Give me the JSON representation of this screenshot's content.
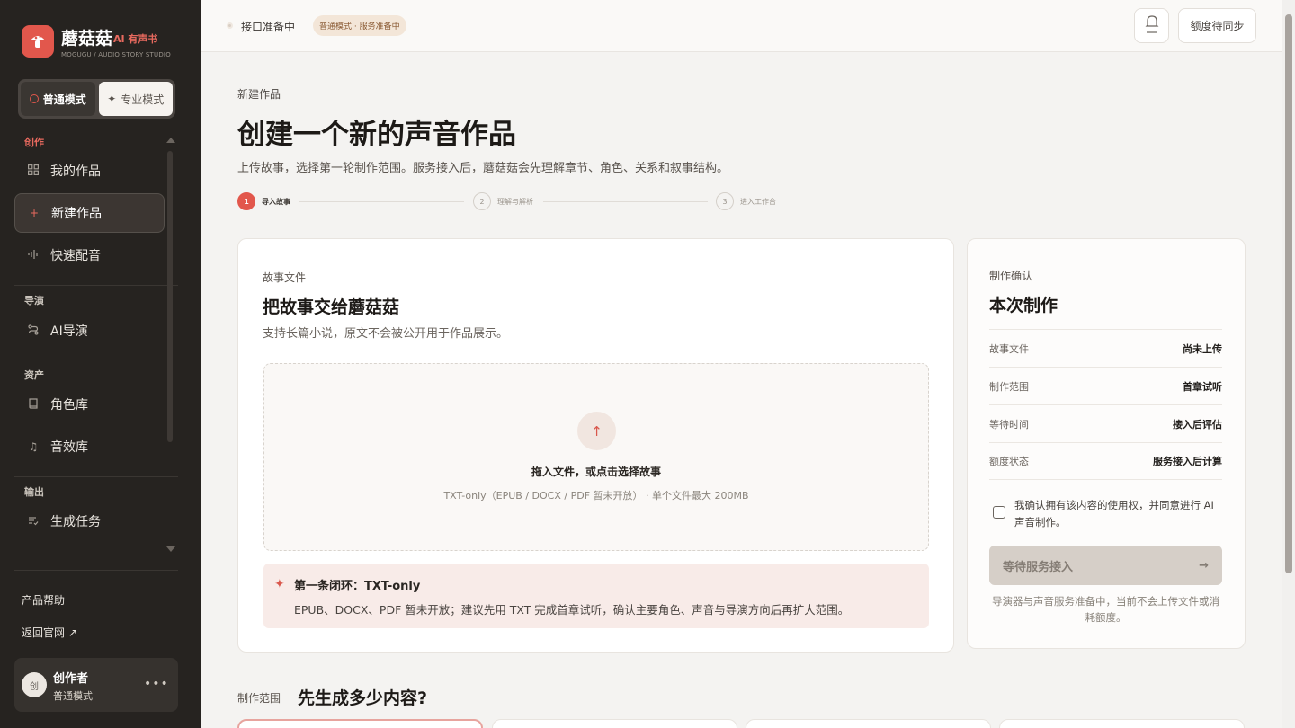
{
  "sidebar": {
    "logo_name": "蘑菇菇",
    "logo_badge": "AI 有声书",
    "logo_sub": "MOGUGU / AUDIO STORY STUDIO",
    "mode_normal": "普通模式",
    "mode_pro": "专业模式",
    "sections": {
      "create": "创作",
      "director": "导演",
      "assets": "资产",
      "output": "输出"
    },
    "items": {
      "my_works": "我的作品",
      "new_work": "新建作品",
      "quick_dub": "快速配音",
      "ai_director": "AI导演",
      "characters": "角色库",
      "sfx": "音效库",
      "tasks": "生成任务"
    },
    "product_help": "产品帮助",
    "back_home": "返回官网 ↗",
    "user": {
      "avatar": "创",
      "name": "创作者",
      "mode": "普通模式",
      "more": "•••"
    }
  },
  "topbar": {
    "status": "接口准备中",
    "mode_pill": "普通模式 · 服务准备中",
    "quota": "额度待同步"
  },
  "main": {
    "breadcrumb": "新建作品",
    "title": "创建一个新的声音作品",
    "description": "上传故事，选择第一轮制作范围。服务接入后，蘑菇菇会先理解章节、角色、关系和叙事结构。",
    "steps": [
      {
        "num": "1",
        "label": "导入故事"
      },
      {
        "num": "2",
        "label": "理解与解析"
      },
      {
        "num": "3",
        "label": "进入工作台"
      }
    ],
    "upload": {
      "eyebrow": "故事文件",
      "title": "把故事交给蘑菇菇",
      "subtitle": "支持长篇小说，原文不会被公开用于作品展示。",
      "drop_title": "拖入文件，或点击选择故事",
      "drop_hint": "TXT-only（EPUB / DOCX / PDF 暂未开放） · 单个文件最大 200MB",
      "notice_title": "第一条闭环：TXT-only",
      "notice_body": "EPUB、DOCX、PDF 暂未开放；建议先用 TXT 完成首章试听，确认主要角色、声音与导演方向后再扩大范围。"
    },
    "summary": {
      "eyebrow": "制作确认",
      "title": "本次制作",
      "rows": [
        {
          "key": "故事文件",
          "value": "尚未上传"
        },
        {
          "key": "制作范围",
          "value": "首章试听"
        },
        {
          "key": "等待时间",
          "value": "接入后评估"
        },
        {
          "key": "额度状态",
          "value": "服务接入后计算"
        }
      ],
      "consent": "我确认拥有该内容的使用权，并同意进行 AI 声音制作。",
      "submit": "等待服务接入",
      "submit_arrow": "→",
      "footnote": "导演器与声音服务准备中，当前不会上传文件或消耗额度。"
    },
    "range": {
      "eyebrow": "制作范围",
      "title": "先生成多少内容?"
    }
  },
  "colors": {
    "accent": "#e2574c",
    "sidebar_bg": "#262320",
    "page_bg": "#f4f3f1"
  }
}
